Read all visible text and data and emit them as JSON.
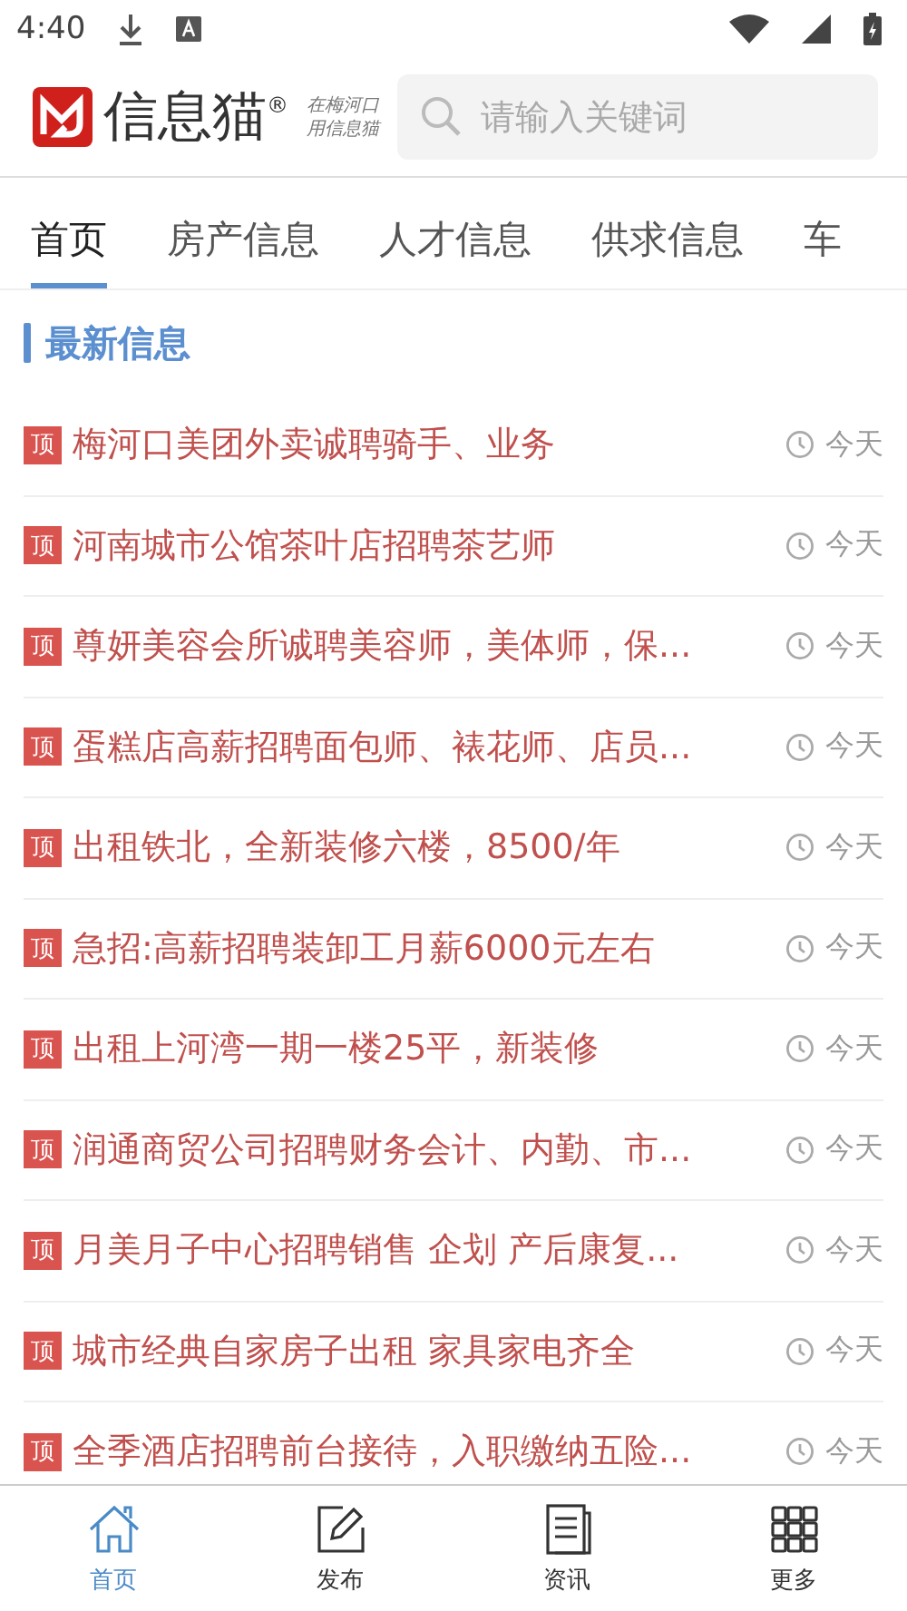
{
  "status_bar": {
    "time": "4:40"
  },
  "header": {
    "brand": "信息猫",
    "registered": "®",
    "tagline": [
      "在梅河口",
      "用信息猫"
    ],
    "search": {
      "placeholder": "请输入关键词"
    }
  },
  "tabs": [
    {
      "label": "首页",
      "selected": true
    },
    {
      "label": "房产信息",
      "selected": false
    },
    {
      "label": "人才信息",
      "selected": false
    },
    {
      "label": "供求信息",
      "selected": false
    },
    {
      "label": "车",
      "selected": false
    }
  ],
  "section_title": "最新信息",
  "items": [
    {
      "badge": "顶",
      "title": "梅河口美团外卖诚聘骑手、业务",
      "time": "今天"
    },
    {
      "badge": "顶",
      "title": "河南城市公馆茶叶店招聘茶艺师",
      "time": "今天"
    },
    {
      "badge": "顶",
      "title": "尊妍美容会所诚聘美容师，美体师，保...",
      "time": "今天"
    },
    {
      "badge": "顶",
      "title": "蛋糕店高薪招聘面包师、裱花师、店员...",
      "time": "今天"
    },
    {
      "badge": "顶",
      "title": "出租铁北，全新装修六楼，8500/年",
      "time": "今天"
    },
    {
      "badge": "顶",
      "title": "急招:高薪招聘装卸工月薪6000元左右",
      "time": "今天"
    },
    {
      "badge": "顶",
      "title": "出租上河湾一期一楼25平，新装修",
      "time": "今天"
    },
    {
      "badge": "顶",
      "title": "润通商贸公司招聘财务会计、内勤、市...",
      "time": "今天"
    },
    {
      "badge": "顶",
      "title": "月美月子中心招聘销售 企划 产后康复...",
      "time": "今天"
    },
    {
      "badge": "顶",
      "title": "城市经典自家房子出租 家具家电齐全",
      "time": "今天"
    },
    {
      "badge": "顶",
      "title": "全季酒店招聘前台接待，入职缴纳五险...",
      "time": "今天"
    }
  ],
  "bottom_nav": [
    {
      "label": "首页",
      "kind": "home",
      "selected": true
    },
    {
      "label": "发布",
      "kind": "edit",
      "selected": false
    },
    {
      "label": "资讯",
      "kind": "news",
      "selected": false
    },
    {
      "label": "更多",
      "kind": "grid",
      "selected": false
    }
  ]
}
